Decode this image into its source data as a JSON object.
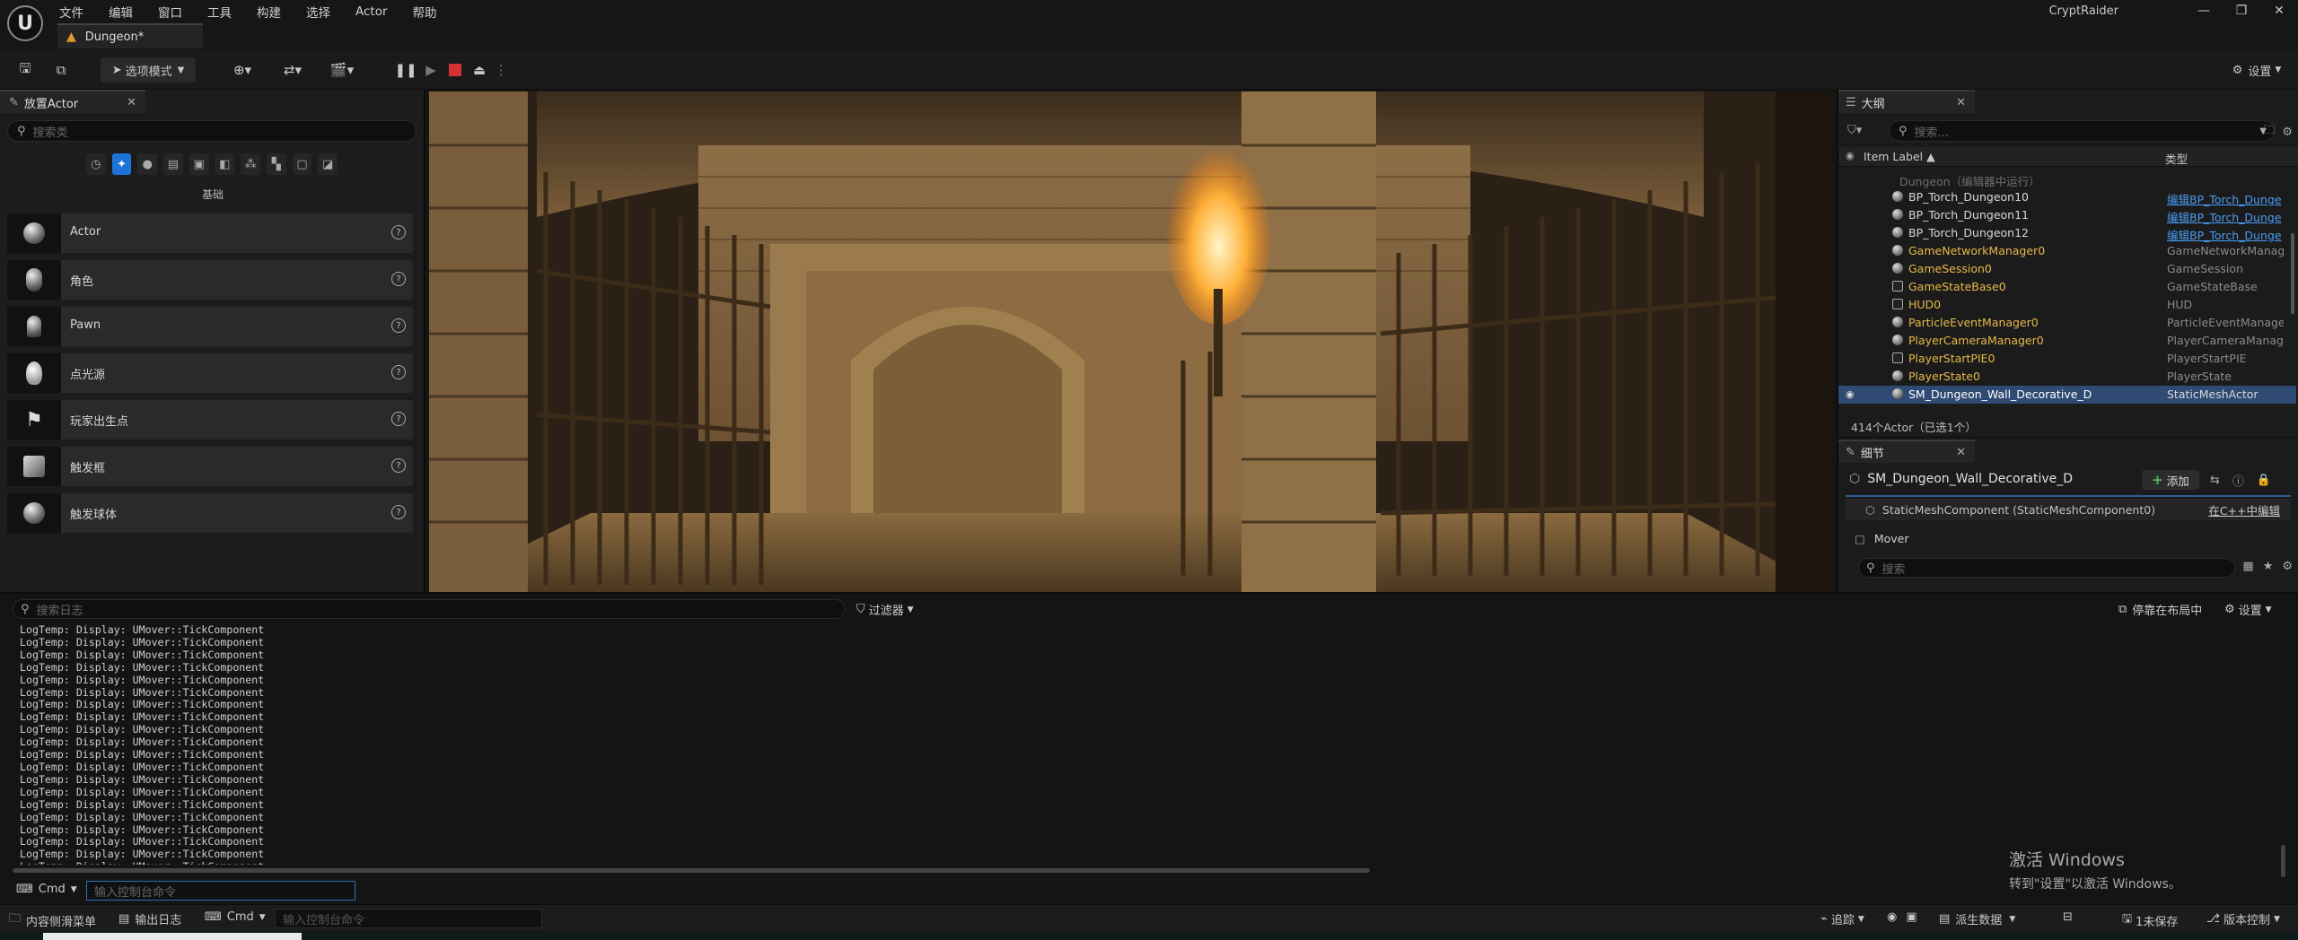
{
  "window": {
    "project": "CryptRaider",
    "menu": [
      "文件",
      "编辑",
      "窗口",
      "工具",
      "构建",
      "选择",
      "Actor",
      "帮助"
    ],
    "doc_tab": "Dungeon*",
    "controls": [
      "—",
      "❐",
      "✕"
    ]
  },
  "toolbar": {
    "mode_label": "选项模式",
    "settings_label": "设置"
  },
  "place_actors": {
    "tab_title": "放置Actor",
    "search_placeholder": "搜索类",
    "category_title": "基础",
    "items": [
      {
        "label": "Actor"
      },
      {
        "label": "角色"
      },
      {
        "label": "Pawn"
      },
      {
        "label": "点光源"
      },
      {
        "label": "玩家出生点"
      },
      {
        "label": "触发框"
      },
      {
        "label": "触发球体"
      }
    ]
  },
  "outliner": {
    "tab_title": "大纲",
    "search_placeholder": "搜索...",
    "col_label": "Item Label ▲",
    "col_type": "类型",
    "rows": [
      {
        "name": "Dungeon（编辑器中运行）",
        "type": ""
      },
      {
        "name": "BP_Torch_Dungeon10",
        "type": "编辑BP_Torch_Dunge"
      },
      {
        "name": "BP_Torch_Dungeon11",
        "type": "编辑BP_Torch_Dunge"
      },
      {
        "name": "BP_Torch_Dungeon12",
        "type": "编辑BP_Torch_Dunge"
      },
      {
        "name": "GameNetworkManager0",
        "type": "GameNetworkManager"
      },
      {
        "name": "GameSession0",
        "type": "GameSession"
      },
      {
        "name": "GameStateBase0",
        "type": "GameStateBase"
      },
      {
        "name": "HUD0",
        "type": "HUD"
      },
      {
        "name": "ParticleEventManager0",
        "type": "ParticleEventManager"
      },
      {
        "name": "PlayerCameraManager0",
        "type": "PlayerCameraManage"
      },
      {
        "name": "PlayerStartPIE0",
        "type": "PlayerStartPIE"
      },
      {
        "name": "PlayerState0",
        "type": "PlayerState"
      },
      {
        "name": "SM_Dungeon_Wall_Decorative_D",
        "type": "StaticMeshActor"
      }
    ],
    "count": "414个Actor（已选1个）"
  },
  "details": {
    "tab_title": "细节",
    "selected_name": "SM_Dungeon_Wall_Decorative_D",
    "add_label": "添加",
    "component": "StaticMeshComponent (StaticMeshComponent0)",
    "cpp_edit": "在C++中编辑",
    "mover": "Mover",
    "search_placeholder": "搜索"
  },
  "log": {
    "search_placeholder": "搜索日志",
    "filter_label": "过滤器",
    "dock_label": "停靠在布局中",
    "settings_label": "设置",
    "line_text": "LogTemp: Display: UMover::TickComponent",
    "line_count": 20,
    "cmd_label": "Cmd",
    "cmd_placeholder": "输入控制台命令",
    "activate_title": "激活 Windows",
    "activate_sub": "转到\"设置\"以激活 Windows。"
  },
  "statusbar": {
    "content_drawer": "内容侧滑菜单",
    "output_log": "输出日志",
    "cmd_label": "Cmd",
    "cmd_placeholder": "输入控制台命令",
    "trace": "追踪",
    "derived_data": "派生数据",
    "unsaved": "1未保存",
    "source_control": "版本控制"
  }
}
